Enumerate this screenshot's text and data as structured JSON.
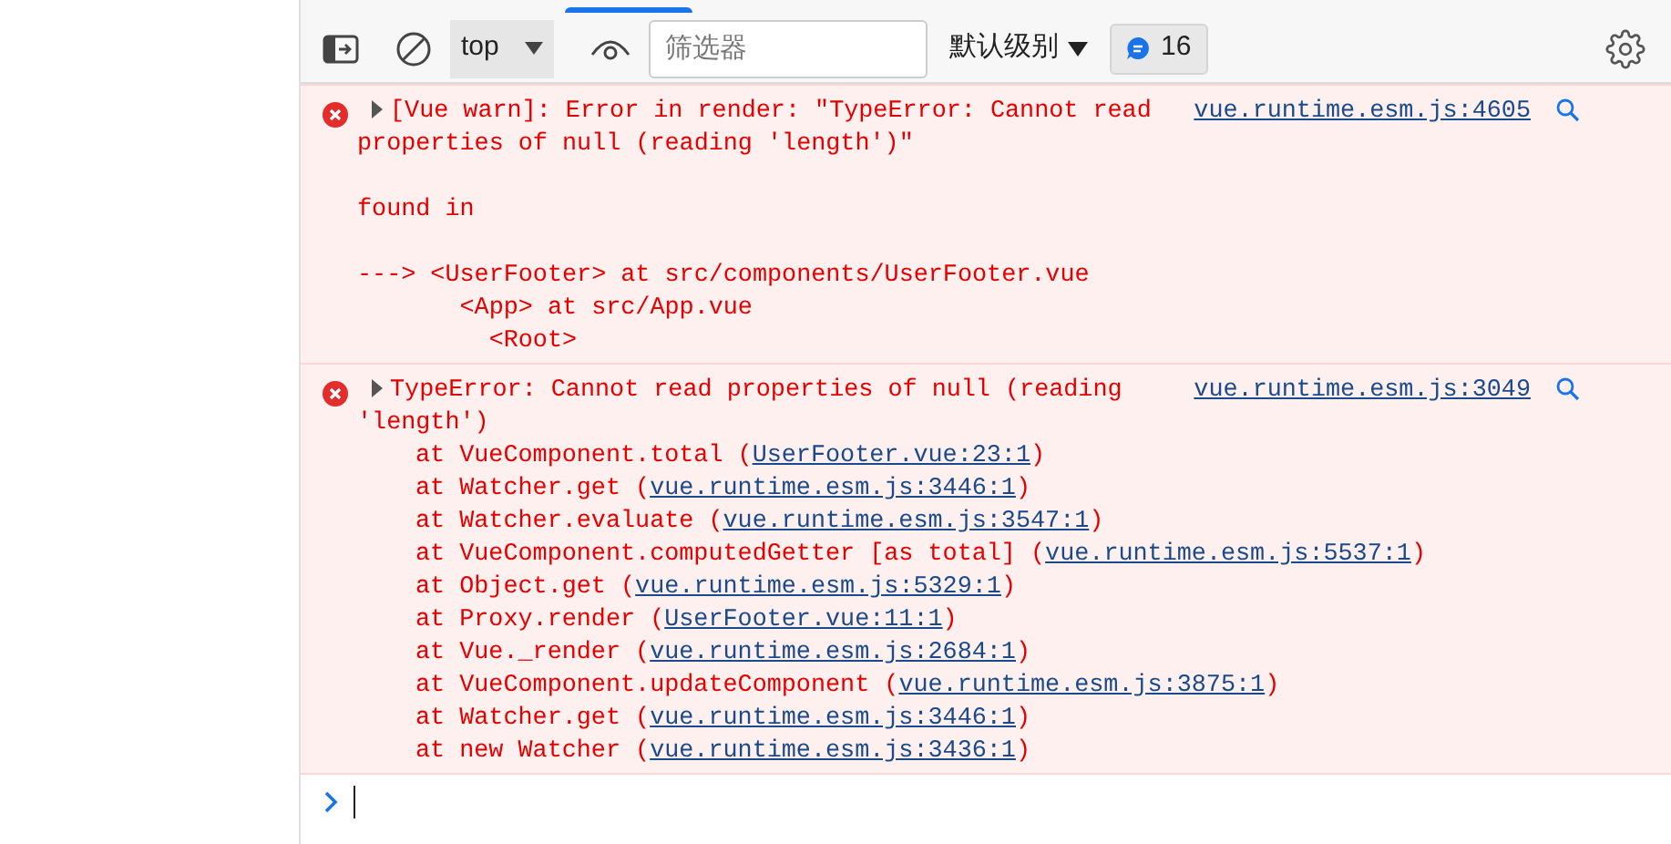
{
  "toolbar": {
    "context": "top",
    "filter": {
      "placeholder": "筛选器"
    },
    "levels": "默认级别",
    "message_count": "16"
  },
  "messages": [
    {
      "kind": "error",
      "text": "[Vue warn]: Error in render: \"TypeError: Cannot read properties of null (reading 'length')\"\n\nfound in\n\n---> <UserFooter> at src/components/UserFooter.vue\n       <App> at src/App.vue\n         <Root>",
      "source": "vue.runtime.esm.js:4605"
    },
    {
      "kind": "error",
      "text": "TypeError: Cannot read properties of null (reading 'length')",
      "source": "vue.runtime.esm.js:3049",
      "frames": [
        {
          "prefix": "at VueComponent.total (",
          "link": "UserFooter.vue:23:1",
          "suffix": ")"
        },
        {
          "prefix": "at Watcher.get (",
          "link": "vue.runtime.esm.js:3446:1",
          "suffix": ")"
        },
        {
          "prefix": "at Watcher.evaluate (",
          "link": "vue.runtime.esm.js:3547:1",
          "suffix": ")"
        },
        {
          "prefix": "at VueComponent.computedGetter [as total] (",
          "link": "vue.runtime.esm.js:5537:1",
          "suffix": ")"
        },
        {
          "prefix": "at Object.get (",
          "link": "vue.runtime.esm.js:5329:1",
          "suffix": ")"
        },
        {
          "prefix": "at Proxy.render (",
          "link": "UserFooter.vue:11:1",
          "suffix": ")"
        },
        {
          "prefix": "at Vue._render (",
          "link": "vue.runtime.esm.js:2684:1",
          "suffix": ")"
        },
        {
          "prefix": "at VueComponent.updateComponent (",
          "link": "vue.runtime.esm.js:3875:1",
          "suffix": ")"
        },
        {
          "prefix": "at Watcher.get (",
          "link": "vue.runtime.esm.js:3446:1",
          "suffix": ")"
        },
        {
          "prefix": "at new Watcher (",
          "link": "vue.runtime.esm.js:3436:1",
          "suffix": ")"
        }
      ]
    }
  ]
}
